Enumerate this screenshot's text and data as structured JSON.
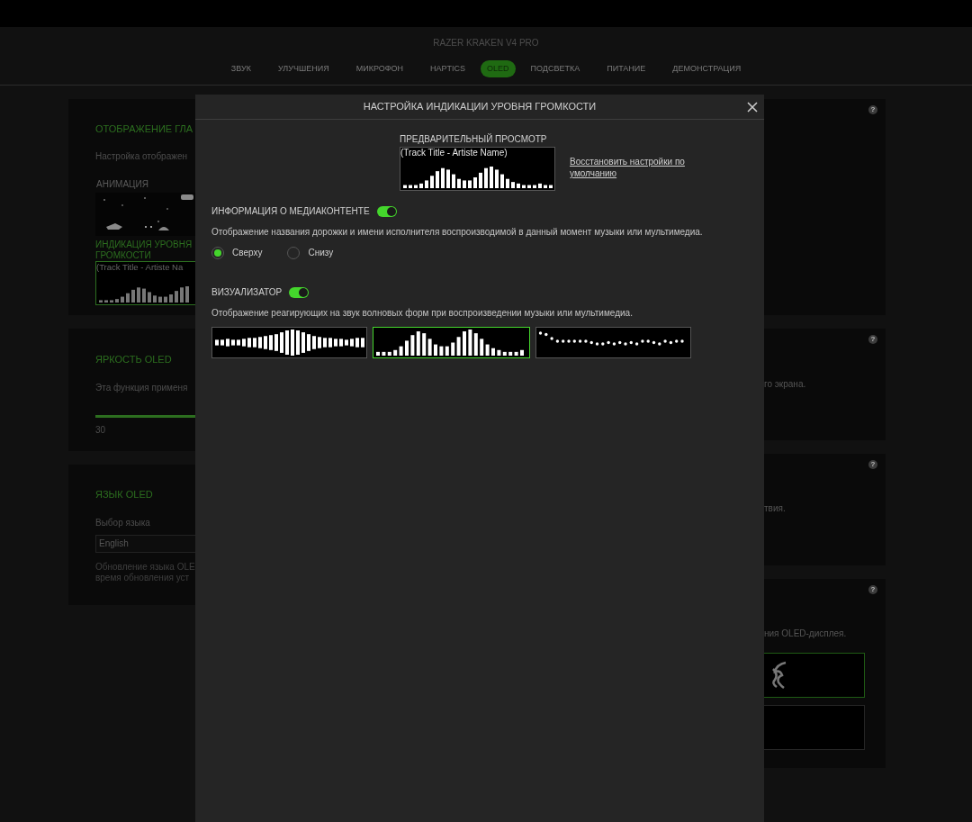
{
  "header": {
    "title": "RAZER KRAKEN V4 PRO",
    "tabs": [
      {
        "label": "ЗВУК",
        "selected": false
      },
      {
        "label": "УЛУЧШЕНИЯ",
        "selected": false
      },
      {
        "label": "МИКРОФОН",
        "selected": false
      },
      {
        "label": "HAPTICS",
        "selected": false
      },
      {
        "label": "OLED",
        "selected": true
      },
      {
        "label": "ПОДСВЕТКА",
        "selected": false
      },
      {
        "label": "ПИТАНИЕ",
        "selected": false
      },
      {
        "label": "ДЕМОНСТРАЦИЯ",
        "selected": false
      }
    ]
  },
  "cards_left": [
    {
      "kind": "display",
      "title": "ОТОБРАЖЕНИЕ ГЛА",
      "description": "Настройка отображен",
      "animation": {
        "label": "АНИМАЦИЯ"
      },
      "volume": {
        "label": "ИНДИКАЦИЯ УРОВНЯ ГРОМКОСТИ",
        "track": "(Track Title - Artiste Na",
        "selected": true
      }
    },
    {
      "kind": "brightness",
      "title": "ЯРКОСТЬ OLED",
      "description": "Эта функция применя",
      "level": 0.3,
      "reading": "30"
    },
    {
      "kind": "language",
      "title": "ЯЗЫК OLED",
      "label": "Выбор языка",
      "value": "English",
      "note": [
        "Обновление языка OLE",
        "время обновления уст"
      ]
    }
  ],
  "cards_right": [
    {
      "help": "?"
    },
    {
      "help": "?",
      "text": "го экрана."
    },
    {
      "help": "?",
      "text": "твия."
    },
    {
      "help": "?",
      "text": "ния OLED-дисплея.",
      "logos": [
        {
          "selected": true
        },
        {
          "selected": false
        }
      ]
    }
  ],
  "modal": {
    "title": "НАСТРОЙКА ИНДИКАЦИИ УРОВНЯ ГРОМКОСТИ",
    "preview": {
      "label": "ПРЕДВАРИТЕЛЬНЫЙ ПРОСМОТР",
      "track": "(Track Title - Artiste Name)"
    },
    "reset_link": "Восстановить настройки по умолчанию",
    "media_info": {
      "label": "ИНФОРМАЦИЯ О МЕДИАКОНТЕНТЕ",
      "on": true,
      "description": "Отображение названия дорожки и имени исполнителя воспроизводимой в данный момент музыки или мультимедиа.",
      "options": [
        {
          "label": "Сверху",
          "selected": true
        },
        {
          "label": "Снизу",
          "selected": false
        }
      ]
    },
    "visualizer": {
      "label": "ВИЗУАЛИЗАТОР",
      "on": true,
      "description": "Отображение реагирующих на звук волновых форм при воспроизведении музыки или мультимедиа.",
      "styles": [
        {
          "kind": "mirrored",
          "selected": false
        },
        {
          "kind": "bars",
          "selected": true
        },
        {
          "kind": "dots",
          "selected": false
        }
      ]
    }
  }
}
